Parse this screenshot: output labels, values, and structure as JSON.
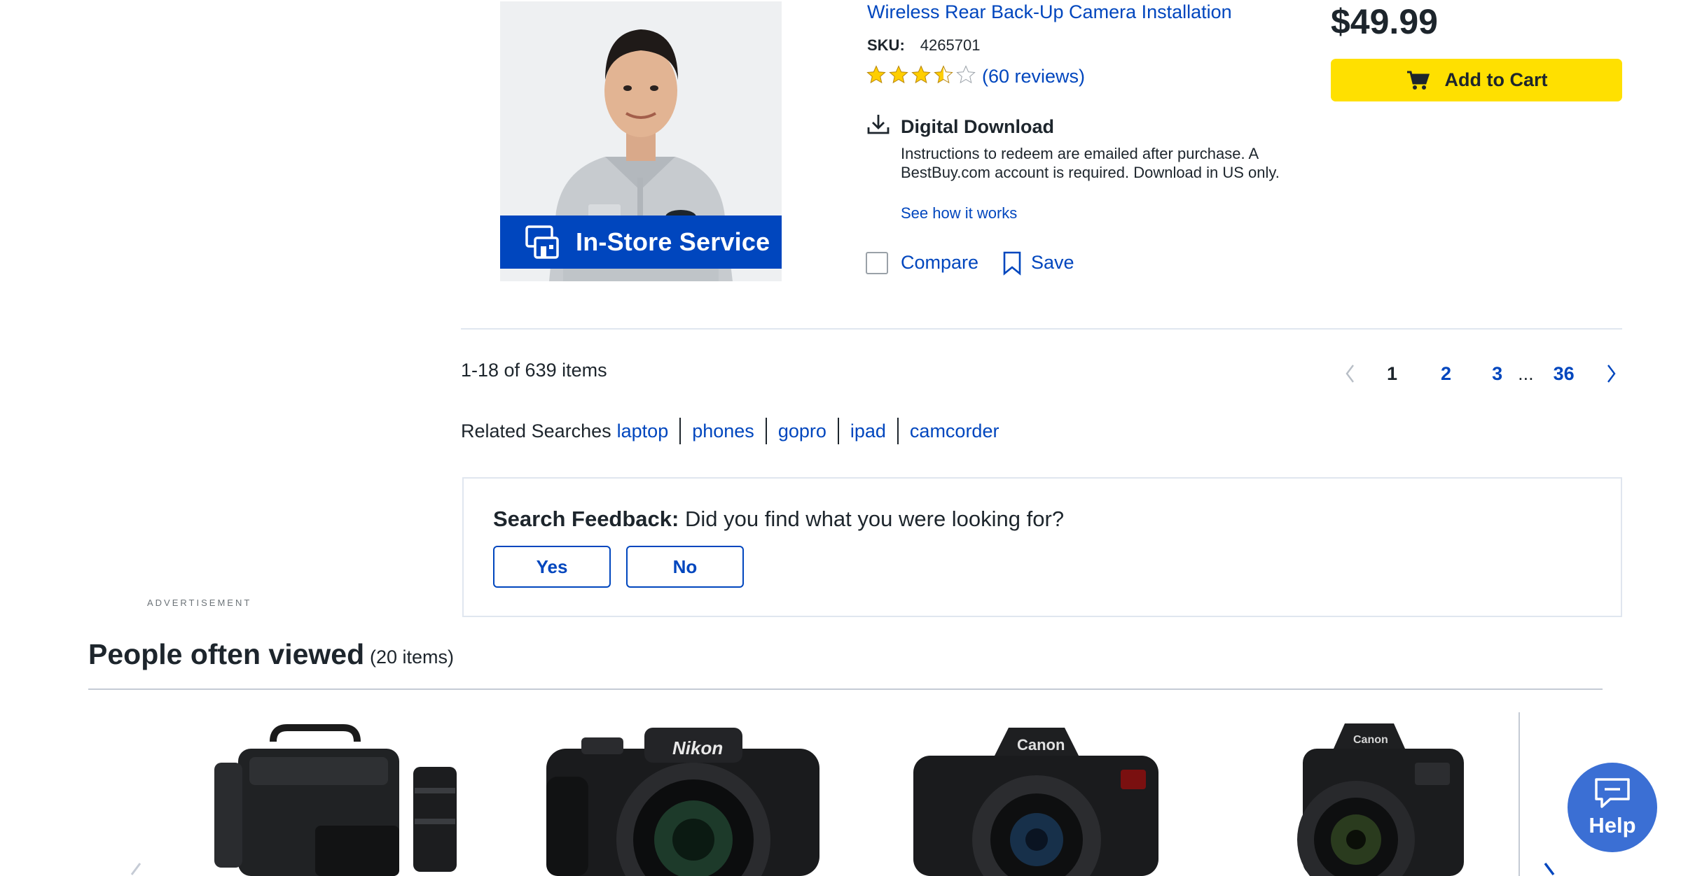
{
  "product": {
    "badge": "In-Store Service",
    "title": "Wireless Rear Back-Up Camera Installation",
    "sku_key": "SKU:",
    "sku_value": "4265701",
    "rating": 3.5,
    "rating_max": 5,
    "reviews": "(60 reviews)",
    "download_title": "Digital Download",
    "download_desc": "Instructions to redeem are emailed after purchase. A BestBuy.com account is required. Download in US only.",
    "download_link": "See how it works",
    "compare_label": "Compare",
    "save_label": "Save",
    "price": "$49.99",
    "add_to_cart": "Add to Cart"
  },
  "results": {
    "count_text": "1-18 of 639 items"
  },
  "pagination": {
    "pages": [
      "1",
      "2",
      "3"
    ],
    "ellipsis": "...",
    "last": "36",
    "current": "1"
  },
  "related": {
    "title": "Related Searches",
    "links": [
      "laptop",
      "phones",
      "gopro",
      "ipad",
      "camcorder"
    ]
  },
  "feedback": {
    "label": "Search Feedback:",
    "question": "Did you find what you were looking for?",
    "yes": "Yes",
    "no": "No"
  },
  "advertisement": "ADVERTISEMENT",
  "people_viewed": {
    "title": "People often viewed",
    "count": "(20 items)"
  },
  "help": {
    "label": "Help"
  },
  "colors": {
    "link_blue": "#0046be",
    "cart_yellow": "#ffe000",
    "help_blue": "#3b6fd4",
    "star_gold": "#ffce00"
  }
}
